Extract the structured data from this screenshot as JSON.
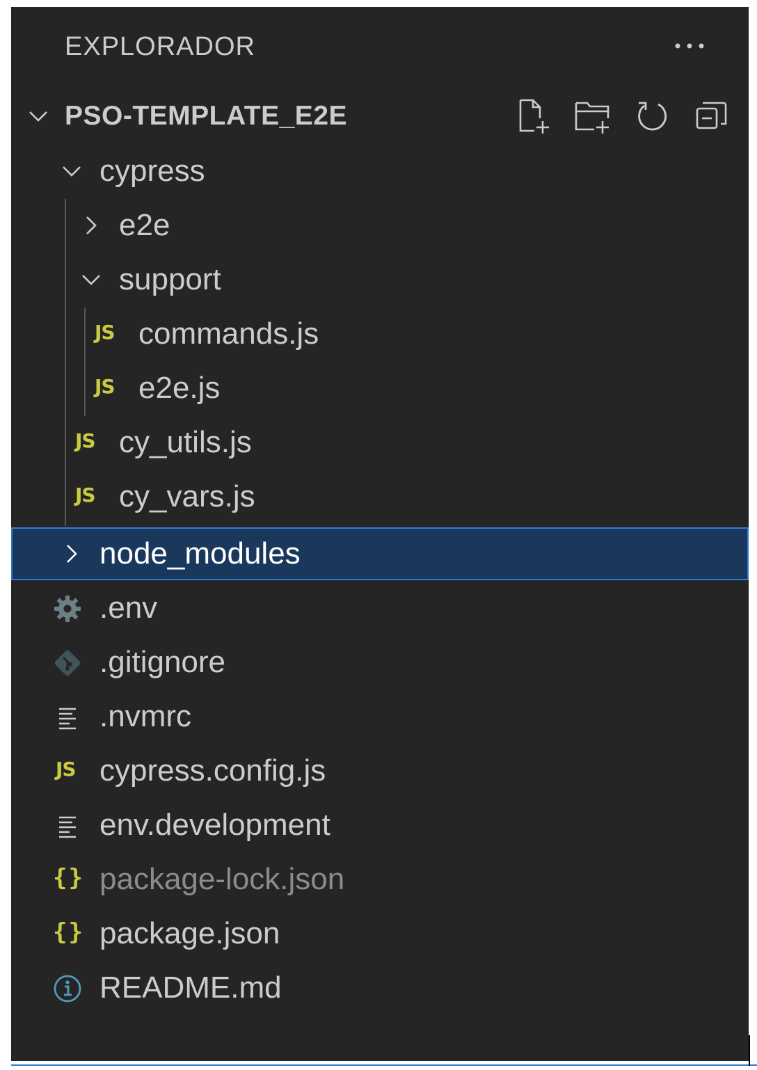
{
  "panel": {
    "title": "EXPLORADOR",
    "more_icon": "ellipsis-icon"
  },
  "project": {
    "name": "PSO-TEMPLATE_E2E",
    "expanded": true,
    "actions": [
      {
        "name": "new-file",
        "icon": "new-file-icon"
      },
      {
        "name": "new-folder",
        "icon": "new-folder-icon"
      },
      {
        "name": "refresh",
        "icon": "refresh-icon"
      },
      {
        "name": "collapse-all",
        "icon": "collapse-all-icon"
      }
    ]
  },
  "tree": [
    {
      "label": "cypress",
      "type": "folder",
      "expanded": true
    },
    {
      "label": "e2e",
      "type": "folder",
      "expanded": false
    },
    {
      "label": "support",
      "type": "folder",
      "expanded": true
    },
    {
      "label": "commands.js",
      "type": "file",
      "icon": "js-icon",
      "icon_text": "JS"
    },
    {
      "label": "e2e.js",
      "type": "file",
      "icon": "js-icon",
      "icon_text": "JS"
    },
    {
      "label": "cy_utils.js",
      "type": "file",
      "icon": "js-icon",
      "icon_text": "JS"
    },
    {
      "label": "cy_vars.js",
      "type": "file",
      "icon": "js-icon",
      "icon_text": "JS"
    },
    {
      "label": "node_modules",
      "type": "folder",
      "expanded": false,
      "selected": true
    },
    {
      "label": ".env",
      "type": "file",
      "icon": "gear-icon"
    },
    {
      "label": ".gitignore",
      "type": "file",
      "icon": "git-icon"
    },
    {
      "label": ".nvmrc",
      "type": "file",
      "icon": "text-lines-icon"
    },
    {
      "label": "cypress.config.js",
      "type": "file",
      "icon": "js-icon",
      "icon_text": "JS"
    },
    {
      "label": "env.development",
      "type": "file",
      "icon": "text-lines-icon"
    },
    {
      "label": "package-lock.json",
      "type": "file",
      "icon": "json-icon",
      "icon_text": "{}",
      "dimmed": true
    },
    {
      "label": "package.json",
      "type": "file",
      "icon": "json-icon",
      "icon_text": "{}"
    },
    {
      "label": "README.md",
      "type": "file",
      "icon": "info-icon"
    }
  ],
  "colors": {
    "background": "#252526",
    "text": "#cccccc",
    "selection_bg": "#19385c",
    "selection_border": "#2f7bd1",
    "js_icon": "#cbcb41",
    "json_icon": "#cbcb41",
    "gear_icon": "#6d8086",
    "git_icon": "#41535b",
    "info_icon": "#519aba",
    "dimmed_text": "#8c8c8c"
  }
}
